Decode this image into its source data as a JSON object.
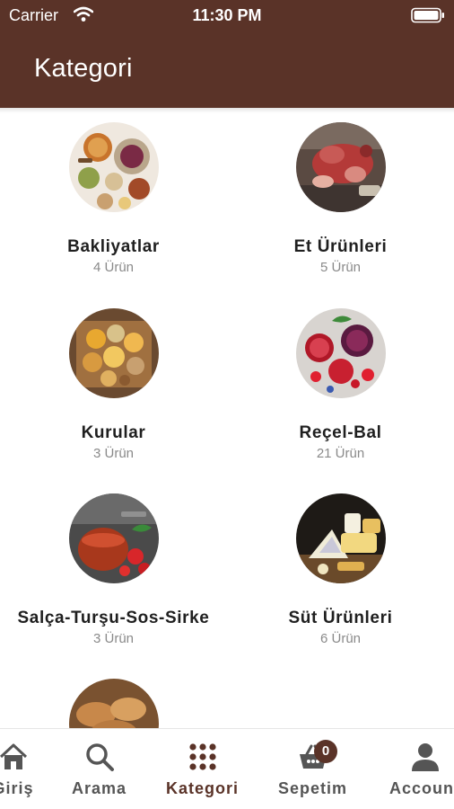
{
  "status_bar": {
    "carrier": "Carrier",
    "time": "11:30 PM"
  },
  "header": {
    "title": "Kategori"
  },
  "categories": [
    {
      "name": "Bakliyatlar",
      "count": "4 Ürün",
      "icon": "legumes-image"
    },
    {
      "name": "Et Ürünleri",
      "count": "5 Ürün",
      "icon": "meat-image"
    },
    {
      "name": "Kurular",
      "count": "3 Ürün",
      "icon": "dried-fruit-image"
    },
    {
      "name": "Reçel-Bal",
      "count": "21 Ürün",
      "icon": "jam-honey-image"
    },
    {
      "name": "Salça-Turşu-Sos-Sirke",
      "count": "3 Ürün",
      "icon": "sauce-image"
    },
    {
      "name": "Süt Ürünleri",
      "count": "6 Ürün",
      "icon": "cheese-image"
    },
    {
      "name": "",
      "count": "",
      "icon": "bakery-image"
    }
  ],
  "tabs": [
    {
      "label": "Giriş",
      "icon": "home-icon"
    },
    {
      "label": "Arama",
      "icon": "search-icon"
    },
    {
      "label": "Kategori",
      "icon": "grid-icon",
      "active": true
    },
    {
      "label": "Sepetim",
      "icon": "basket-icon",
      "badge": "0"
    },
    {
      "label": "Account",
      "icon": "user-icon"
    }
  ],
  "colors": {
    "brand": "#5a3328",
    "inactive": "#555555",
    "count": "#8a8a8a"
  }
}
